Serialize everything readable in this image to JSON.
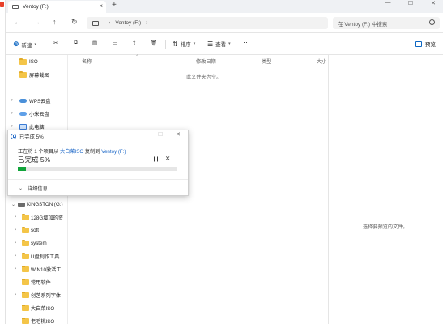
{
  "tab": {
    "title": "Ventoy (F:)"
  },
  "window_controls": {
    "minimize": "—",
    "maximize": "☐",
    "close": "✕"
  },
  "address": {
    "location": "Ventoy (F:)",
    "search_placeholder": "在 Ventoy (F:) 中搜索"
  },
  "commands": {
    "new": "新建",
    "sort": "排序",
    "view": "查看",
    "more": "···",
    "preview": "预览"
  },
  "columns": [
    "名称",
    "修改日期",
    "类型",
    "大小"
  ],
  "empty_message": "此文件夹为空。",
  "preview_message": "选择要预览的文件。",
  "nav": [
    {
      "label": "ISO",
      "icon": "folder-icon"
    },
    {
      "label": "屏幕截图",
      "icon": "folder-icon"
    },
    {
      "label": "WPS云盘",
      "icon": "wps-cloud-icon"
    },
    {
      "label": "小米云盘",
      "icon": "mi-cloud-icon"
    },
    {
      "label": "此电脑",
      "icon": "computer-icon"
    },
    {
      "label": "KINGSTON (G:)",
      "icon": "usb-drive-icon"
    },
    {
      "label": "128G增加的资",
      "icon": "folder-icon"
    },
    {
      "label": "soft",
      "icon": "folder-icon"
    },
    {
      "label": "system",
      "icon": "folder-icon"
    },
    {
      "label": "U盘制作工具",
      "icon": "folder-icon"
    },
    {
      "label": "WIN10激活工",
      "icon": "folder-icon"
    },
    {
      "label": "常用软件",
      "icon": "folder-icon"
    },
    {
      "label": "创艺系列字体",
      "icon": "folder-icon"
    },
    {
      "label": "大白菜ISO",
      "icon": "folder-icon"
    },
    {
      "label": "老毛桃ISO",
      "icon": "folder-icon"
    }
  ],
  "dialog": {
    "title": "已完成 5%",
    "line_prefix": "正在将 1 个项目从",
    "source": "大白菜ISO",
    "line_mid": "复制到",
    "destination": "Ventoy (F:)",
    "percent_text": "已完成 5%",
    "progress": 0.05,
    "details_label": "详细信息"
  },
  "colors": {
    "accent": "#0c66c2",
    "progress": "#11a43a",
    "folder": "#f4c548"
  }
}
